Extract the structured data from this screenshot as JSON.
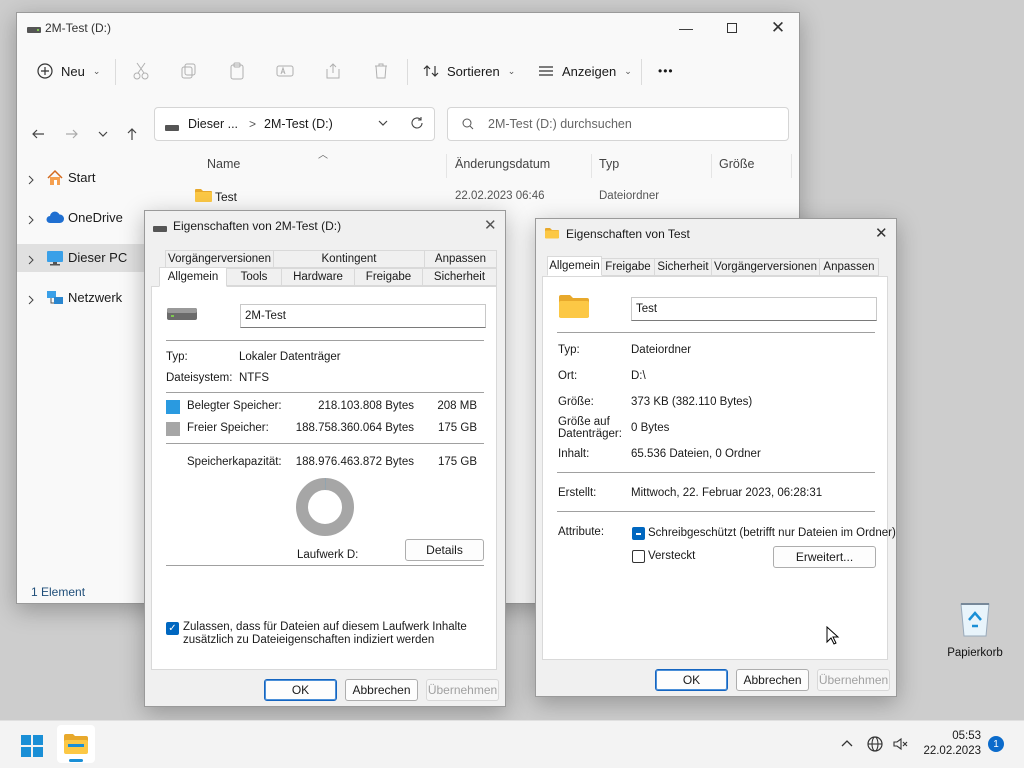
{
  "explorer": {
    "title": "2M-Test (D:)",
    "toolbar": {
      "new_label": "Neu",
      "sort_label": "Sortieren",
      "view_label": "Anzeigen",
      "more_label": "•••"
    },
    "address": {
      "crumb1": "Dieser ...",
      "sep": ">",
      "crumb2": "2M-Test (D:)"
    },
    "search": {
      "placeholder": "2M-Test (D:) durchsuchen"
    },
    "nav": [
      {
        "label": "Start"
      },
      {
        "label": "OneDrive"
      },
      {
        "label": "Dieser PC"
      },
      {
        "label": "Netzwerk"
      }
    ],
    "columns": [
      "Name",
      "Änderungsdatum",
      "Typ",
      "Größe"
    ],
    "rows": [
      {
        "name": "Test",
        "date": "22.02.2023 06:46",
        "type": "Dateiordner",
        "size": ""
      }
    ],
    "status": "1 Element"
  },
  "drive_props": {
    "title": "Eigenschaften von 2M-Test (D:)",
    "tabs_row1": [
      "Vorgängerversionen",
      "Kontingent",
      "Anpassen"
    ],
    "tabs_row2": [
      "Allgemein",
      "Tools",
      "Hardware",
      "Freigabe",
      "Sicherheit"
    ],
    "name_value": "2M-Test",
    "type_label": "Typ:",
    "type_value": "Lokaler Datenträger",
    "fs_label": "Dateisystem:",
    "fs_value": "NTFS",
    "used_label": "Belegter Speicher:",
    "used_bytes": "218.103.808 Bytes",
    "used_short": "208 MB",
    "free_label": "Freier Speicher:",
    "free_bytes": "188.758.360.064 Bytes",
    "free_short": "175 GB",
    "cap_label": "Speicherkapazität:",
    "cap_bytes": "188.976.463.872 Bytes",
    "cap_short": "175 GB",
    "drive_label": "Laufwerk D:",
    "details_button": "Details",
    "index_text_1": "Zulassen, dass für Dateien auf diesem Laufwerk Inhalte",
    "index_text_2": "zusätzlich zu Dateieigenschaften indiziert werden",
    "ok": "OK",
    "cancel": "Abbrechen",
    "apply": "Übernehmen",
    "used_color": "#2a9ae0",
    "free_color": "#a6a6a6",
    "used_fraction": 0.00115
  },
  "folder_props": {
    "title": "Eigenschaften von Test",
    "tabs": [
      "Allgemein",
      "Freigabe",
      "Sicherheit",
      "Vorgängerversionen",
      "Anpassen"
    ],
    "name_value": "Test",
    "type_label": "Typ:",
    "type_value": "Dateiordner",
    "location_label": "Ort:",
    "location_value": "D:\\",
    "size_label": "Größe:",
    "size_value": "373 KB (382.110 Bytes)",
    "disk_label_1": "Größe auf",
    "disk_label_2": "Datenträger:",
    "disk_value": "0 Bytes",
    "content_label": "Inhalt:",
    "content_value": "65.536 Dateien, 0 Ordner",
    "created_label": "Erstellt:",
    "created_value": "Mittwoch, 22. Februar 2023, 06:28:31",
    "attr_label": "Attribute:",
    "readonly_label": "Schreibgeschützt (betrifft nur Dateien im Ordner)",
    "hidden_label": "Versteckt",
    "advanced_button": "Erweitert...",
    "ok": "OK",
    "cancel": "Abbrechen",
    "apply": "Übernehmen"
  },
  "desktop": {
    "recycle_label": "Papierkorb"
  },
  "taskbar": {
    "time": "05:53",
    "date": "22.02.2023",
    "notification_count": "1"
  }
}
